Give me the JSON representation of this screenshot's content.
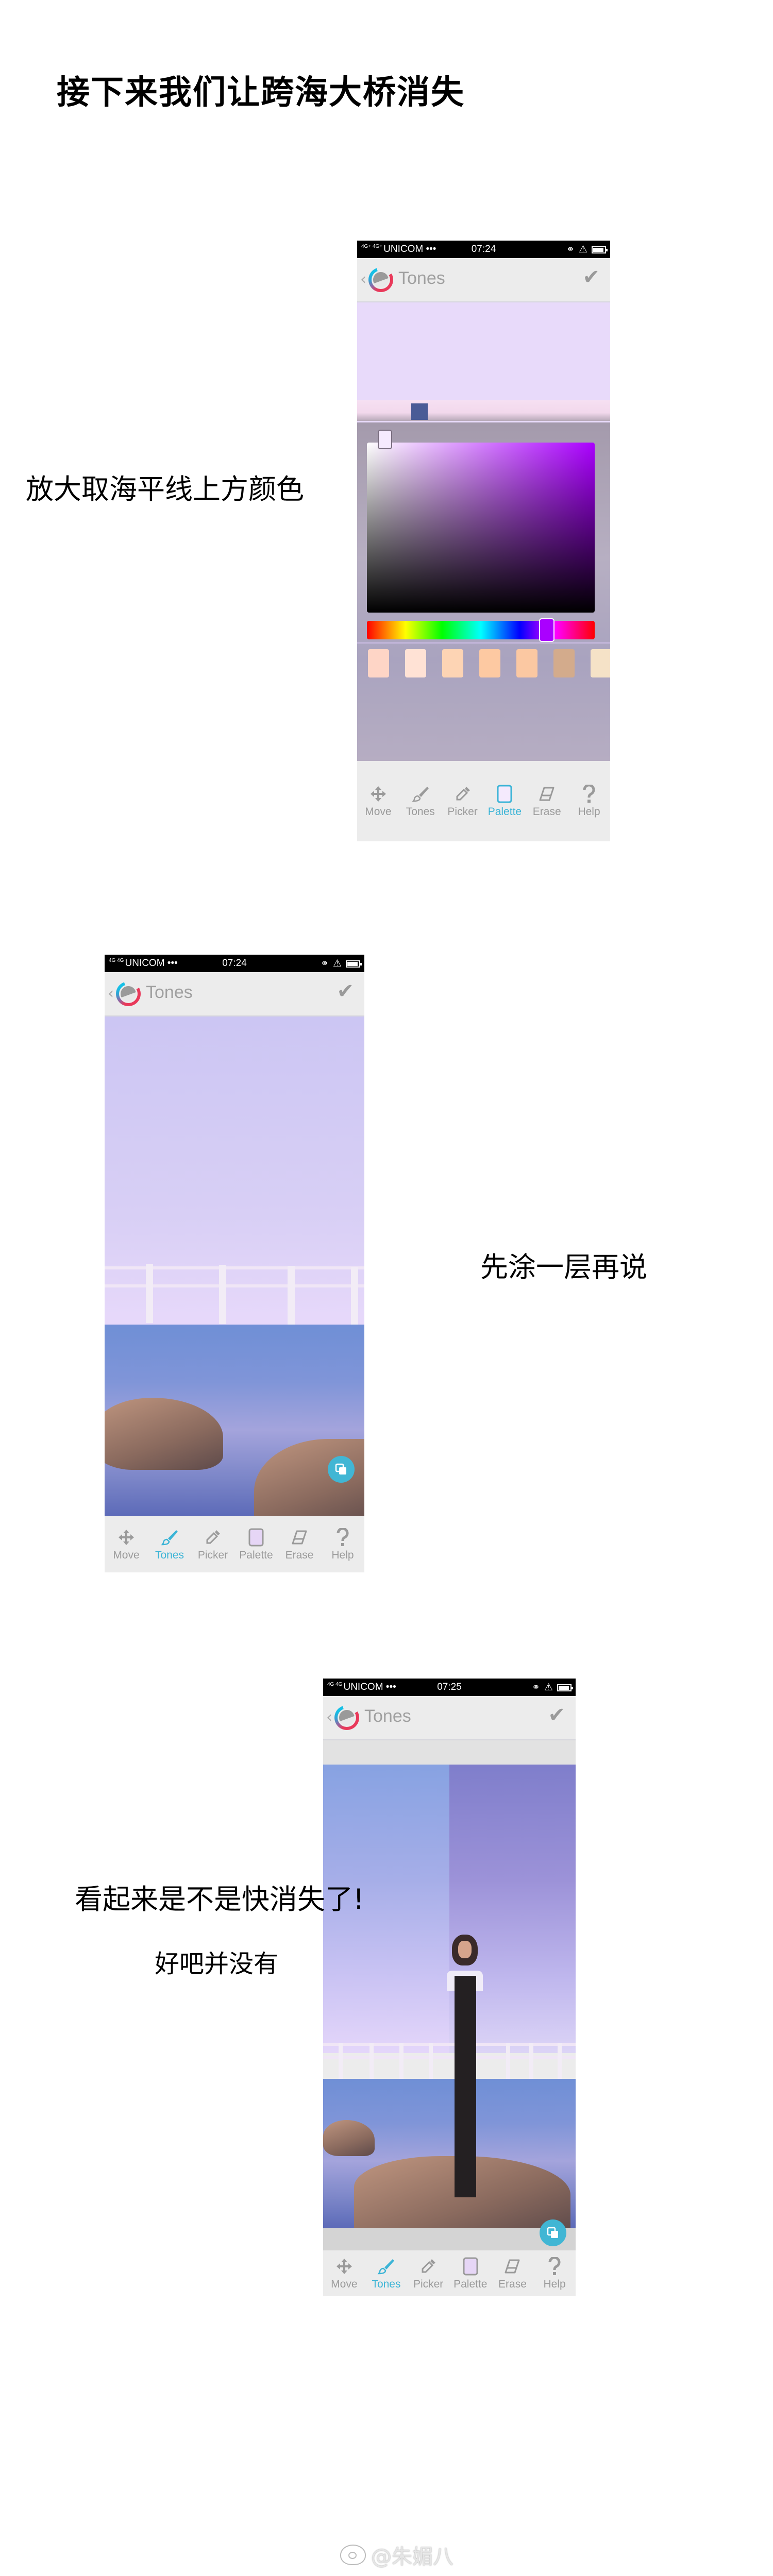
{
  "title": "接下来我们让跨海大桥消失",
  "captions": {
    "step1": "放大取海平线上方颜色",
    "step2": "先涂一层再说",
    "step3a": "看起来是不是快消失了!",
    "step3b": "好吧并没有"
  },
  "watermark": "@朱媚八",
  "screens": [
    {
      "status": {
        "network": "4G+ 4G+",
        "carrier": "UNICOM •••",
        "time": "07:24",
        "battery_level": 0.9
      },
      "header": {
        "back": "‹",
        "title": "Tones",
        "confirm": "✔"
      },
      "color_picker": {
        "selected_color": "#f6eafe",
        "hue_color": "#aa00ff",
        "hue_position": 0.79,
        "swatches": [
          "#fed5c6",
          "#ffe2d5",
          "#fdd4b4",
          "#fdc9a2",
          "#fbc8a2",
          "#d3ab8c",
          "#f5e2c7"
        ]
      },
      "toolbar": [
        {
          "label": "Move",
          "icon": "move-icon",
          "active": false
        },
        {
          "label": "Tones",
          "icon": "brush-icon",
          "active": false
        },
        {
          "label": "Picker",
          "icon": "eyedropper-icon",
          "active": false
        },
        {
          "label": "Palette",
          "icon": "palette-icon",
          "active": true
        },
        {
          "label": "Erase",
          "icon": "eraser-icon",
          "active": false
        },
        {
          "label": "Help",
          "icon": "help-icon",
          "active": false
        }
      ]
    },
    {
      "status": {
        "network": "4G 4G",
        "carrier": "UNICOM •••",
        "time": "07:24",
        "battery_level": 0.9
      },
      "header": {
        "back": "‹",
        "title": "Tones",
        "confirm": "✔"
      },
      "toolbar": [
        {
          "label": "Move",
          "icon": "move-icon",
          "active": false
        },
        {
          "label": "Tones",
          "icon": "brush-icon",
          "active": true
        },
        {
          "label": "Picker",
          "icon": "eyedropper-icon",
          "active": false
        },
        {
          "label": "Palette",
          "icon": "palette-icon",
          "active": false
        },
        {
          "label": "Erase",
          "icon": "eraser-icon",
          "active": false
        },
        {
          "label": "Help",
          "icon": "help-icon",
          "active": false
        }
      ]
    },
    {
      "status": {
        "network": "4G 4G",
        "carrier": "UNICOM •••",
        "time": "07:25",
        "battery_level": 0.9
      },
      "header": {
        "back": "‹",
        "title": "Tones",
        "confirm": "✔"
      },
      "toolbar": [
        {
          "label": "Move",
          "icon": "move-icon",
          "active": false
        },
        {
          "label": "Tones",
          "icon": "brush-icon",
          "active": true
        },
        {
          "label": "Picker",
          "icon": "eyedropper-icon",
          "active": false
        },
        {
          "label": "Palette",
          "icon": "palette-icon",
          "active": false
        },
        {
          "label": "Erase",
          "icon": "eraser-icon",
          "active": false
        },
        {
          "label": "Help",
          "icon": "help-icon",
          "active": false
        }
      ]
    }
  ],
  "colors": {
    "accent": "#3bb4d6",
    "inactive": "#9a9a9a",
    "fab": "#41b6d4"
  }
}
